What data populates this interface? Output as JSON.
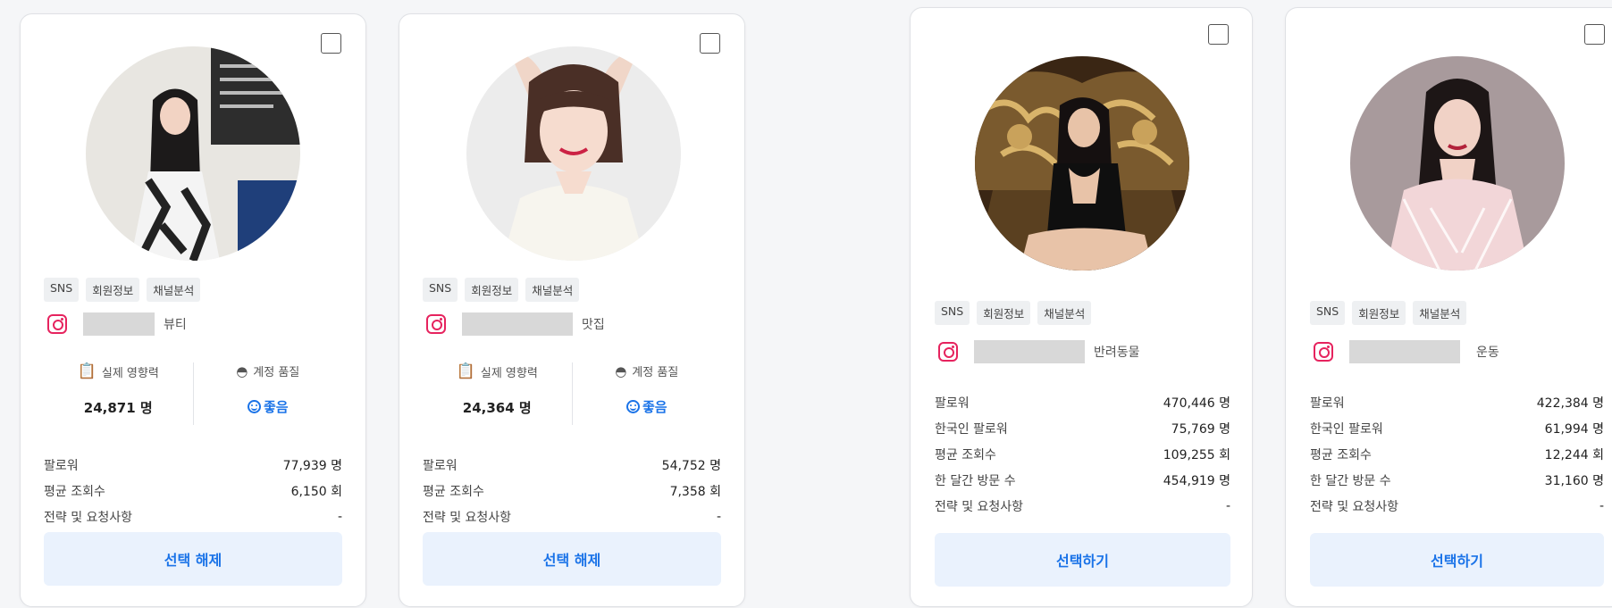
{
  "tags": [
    "SNS",
    "회원정보",
    "채널분석"
  ],
  "labels": {
    "real_influence": "실제 영향력",
    "account_quality": "계정 품질",
    "followers": "팔로워",
    "korean_followers": "한국인 팔로워",
    "avg_views": "평균 조회수",
    "monthly_visits": "한 달간 방문 수",
    "strategy": "전략 및 요청사항"
  },
  "cards": [
    {
      "category": "뷰티",
      "real_influence": "24,871 명",
      "quality": "좋음",
      "followers": "77,939 명",
      "avg_views": "6,150 회",
      "strategy": "-",
      "button": "선택 해제"
    },
    {
      "category": "맛집",
      "real_influence": "24,364 명",
      "quality": "좋음",
      "followers": "54,752 명",
      "avg_views": "7,358 회",
      "strategy": "-",
      "button": "선택 해제"
    },
    {
      "category": "반려동물",
      "followers": "470,446 명",
      "korean_followers": "75,769 명",
      "avg_views": "109,255 회",
      "monthly_visits": "454,919 명",
      "strategy": "-",
      "button": "선택하기"
    },
    {
      "category": "운동",
      "followers": "422,384 명",
      "korean_followers": "61,994 명",
      "avg_views": "12,244 회",
      "monthly_visits": "31,160 명",
      "strategy": "-",
      "button": "선택하기"
    }
  ],
  "colors": {
    "accent": "#1a73e8",
    "button_bg": "#eaf2fd",
    "instagram": "#e6235e"
  }
}
